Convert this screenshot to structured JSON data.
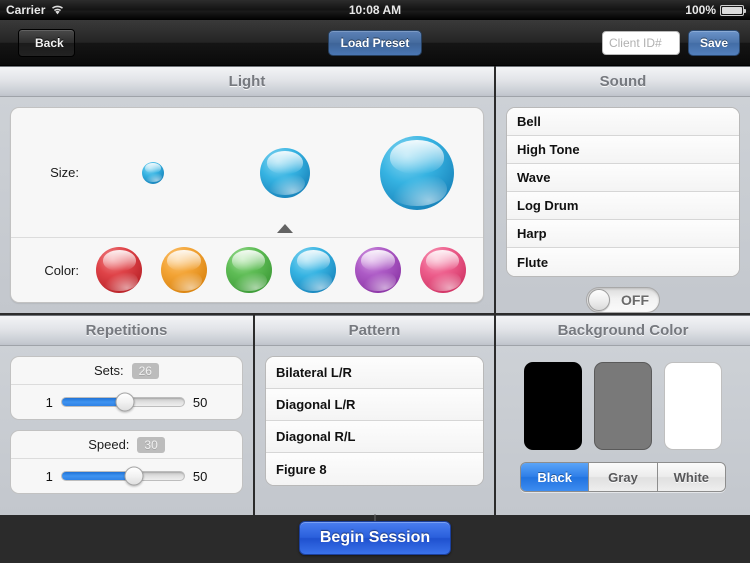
{
  "statusbar": {
    "carrier": "Carrier",
    "wifi_icon": "wifi-icon",
    "time": "10:08 AM",
    "battery_percent": "100%",
    "battery_icon": "battery-full-icon"
  },
  "navbar": {
    "back_label": "Back",
    "load_preset_label": "Load Preset",
    "client_id_value": "",
    "client_id_placeholder": "Client ID#",
    "save_label": "Save"
  },
  "light": {
    "title": "Light",
    "size_label": "Size:",
    "sizes": [
      {
        "name": "small",
        "diameter": 22,
        "selected": false
      },
      {
        "name": "medium",
        "diameter": 50,
        "selected": true
      },
      {
        "name": "large",
        "diameter": 74,
        "selected": false
      }
    ],
    "size_color": "#29a8dc",
    "color_label": "Color:",
    "colors": [
      {
        "name": "red",
        "hex": "#d32f34"
      },
      {
        "name": "orange",
        "hex": "#ef9320"
      },
      {
        "name": "green",
        "hex": "#4fb04a"
      },
      {
        "name": "blue",
        "hex": "#29a8dc"
      },
      {
        "name": "purple",
        "hex": "#a650bd"
      },
      {
        "name": "pink",
        "hex": "#e8507e"
      }
    ],
    "selected_color": "blue"
  },
  "sound": {
    "title": "Sound",
    "options": [
      "Bell",
      "High Tone",
      "Wave",
      "Log Drum",
      "Harp",
      "Flute"
    ],
    "toggle_label": "OFF",
    "toggle_on": false
  },
  "repetitions": {
    "title": "Repetitions",
    "sets": {
      "label": "Sets:",
      "value": "26",
      "min": "1",
      "max": "50",
      "percent": 52
    },
    "speed": {
      "label": "Speed:",
      "value": "30",
      "min": "1",
      "max": "50",
      "percent": 59
    }
  },
  "pattern": {
    "title": "Pattern",
    "options": [
      "Bilateral L/R",
      "Diagonal L/R",
      "Diagonal R/L",
      "Figure 8"
    ]
  },
  "background_color": {
    "title": "Background Color",
    "swatches": [
      {
        "name": "black",
        "hex": "#000000"
      },
      {
        "name": "gray",
        "hex": "#797979"
      },
      {
        "name": "white",
        "hex": "#ffffff"
      }
    ],
    "segments": [
      "Black",
      "Gray",
      "White"
    ],
    "selected_segment": "Black"
  },
  "footer": {
    "begin_label": "Begin Session"
  }
}
